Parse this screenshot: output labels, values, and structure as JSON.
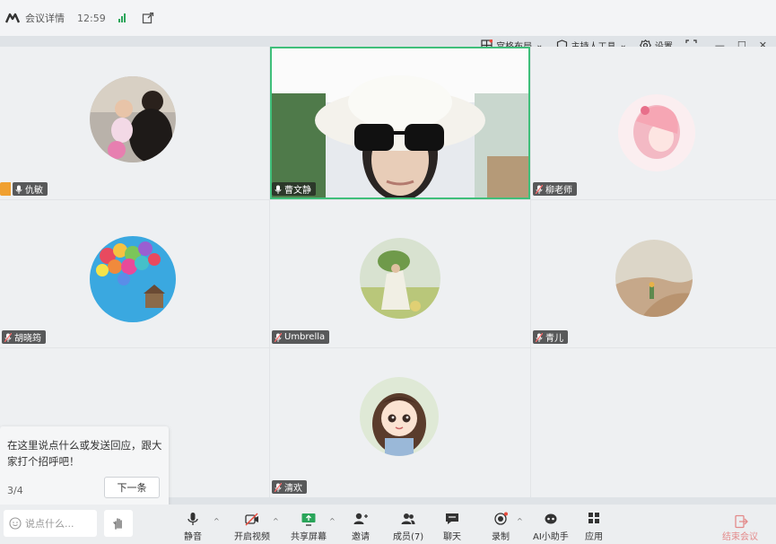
{
  "app": {
    "title": "会议详情",
    "time": "12:59"
  },
  "toolbar_top": {
    "layout_label": "宫格布局",
    "host_tools_label": "主持人工具",
    "settings_label": "设置"
  },
  "window_controls": [
    "—",
    "☐",
    "✕"
  ],
  "participants": [
    {
      "name": "仇敏",
      "active": false
    },
    {
      "name": "曹文静",
      "active": true
    },
    {
      "name": "柳老师",
      "active": false
    },
    {
      "name": "胡晓筠",
      "active": false
    },
    {
      "name": "Umbrella",
      "active": false
    },
    {
      "name": "青儿",
      "active": false
    },
    {
      "name": "清欢",
      "active": false
    }
  ],
  "tip": {
    "text": "在这里说点什么或发送回应，跟大家打个招呼吧！",
    "counter": "3/4",
    "next_label": "下一条"
  },
  "bottom": {
    "input_placeholder": "说点什么...",
    "mute_label": "静音",
    "video_label": "开启视频",
    "share_label": "共享屏幕",
    "invite_label": "邀请",
    "members_label": "成员(7)",
    "chat_label": "聊天",
    "record_label": "录制",
    "ai_label": "AI小助手",
    "apps_label": "应用",
    "leave_label": "结束会议"
  },
  "colors": {
    "accent_green": "#3fbf7a",
    "signal_green": "#2aa55a",
    "host_orange": "#f0a030",
    "leave_red": "#e06060"
  }
}
